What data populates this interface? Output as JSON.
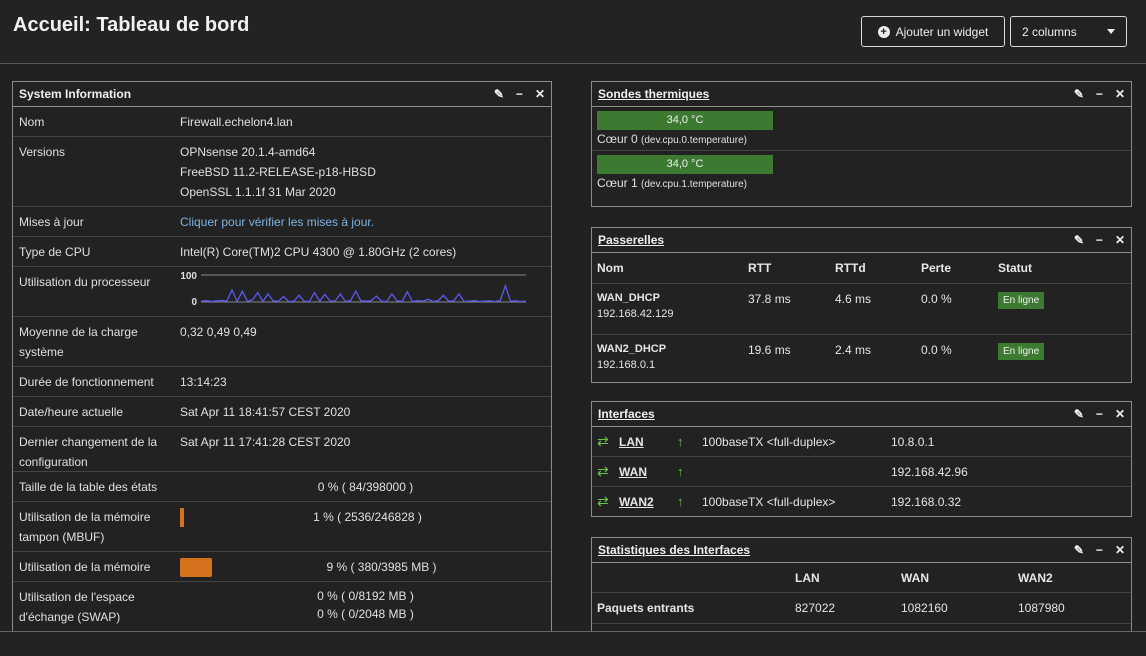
{
  "header": {
    "title": "Accueil: Tableau de bord",
    "add_widget": "Ajouter un widget",
    "columns": "2 columns"
  },
  "system": {
    "title": "System Information",
    "rows": {
      "name_label": "Nom",
      "name_value": "Firewall.echelon4.lan",
      "versions_label": "Versions",
      "versions_1": "OPNsense 20.1.4-amd64",
      "versions_2": "FreeBSD 11.2-RELEASE-p18-HBSD",
      "versions_3": "OpenSSL 1.1.1f 31 Mar 2020",
      "updates_label": "Mises à jour",
      "updates_value": "Cliquer pour vérifier les mises à jour.",
      "cpu_label": "Type de CPU",
      "cpu_value": "Intel(R) Core(TM)2 CPU 4300 @ 1.80GHz (2 cores)",
      "cpu_usage_label": "Utilisation du processeur",
      "cpu_max": "100",
      "cpu_min": "0",
      "load_label": "Moyenne de la charge système",
      "load_value": "0,32 0,49 0,49",
      "uptime_label": "Durée de fonctionnement",
      "uptime_value": "13:14:23",
      "date_label": "Date/heure actuelle",
      "date_value": "Sat Apr 11 18:41:57 CEST 2020",
      "config_label": "Dernier changement de la configuration",
      "config_value": "Sat Apr 11 17:41:28 CEST 2020",
      "states_label": "Taille de la table des états",
      "states_value": "0 % ( 84/398000 )",
      "mbuf_label": "Utilisation de la mémoire tampon (MBUF)",
      "mbuf_value": "1 % ( 2536/246828 )",
      "mbuf_fraction": 0.01,
      "mem_label": "Utilisation de la mémoire",
      "mem_value": "9 % ( 380/3985 MB )",
      "mem_fraction": 0.09,
      "swap_label": "Utilisation de l'espace d'échange (SWAP)",
      "swap_value_1": "0 % ( 0/8192 MB )",
      "swap_value_2": "0 % ( 0/2048 MB )"
    },
    "cpu_series": [
      3,
      5,
      2,
      4,
      6,
      3,
      45,
      2,
      40,
      3,
      8,
      35,
      2,
      30,
      4,
      3,
      20,
      2,
      3,
      25,
      3,
      2,
      35,
      3,
      28,
      4,
      3,
      30,
      2,
      5,
      40,
      4,
      3,
      5,
      22,
      3,
      2,
      30,
      4,
      3,
      38,
      2,
      5,
      3,
      10,
      2,
      5,
      25,
      3,
      4,
      30,
      2,
      3,
      5,
      2,
      3,
      4,
      2,
      5,
      60,
      3,
      4,
      2,
      3
    ]
  },
  "thermal": {
    "title": "Sondes thermiques",
    "sensors": [
      {
        "value": "34,0 °C",
        "name": "Cœur 0",
        "device": "(dev.cpu.0.temperature)"
      },
      {
        "value": "34,0 °C",
        "name": "Cœur 1",
        "device": "(dev.cpu.1.temperature)"
      }
    ]
  },
  "gateways": {
    "title": "Passerelles",
    "columns": [
      "Nom",
      "RTT",
      "RTTd",
      "Perte",
      "Statut"
    ],
    "rows": [
      {
        "name": "WAN_DHCP",
        "ip": "192.168.42.129",
        "rtt": "37.8 ms",
        "rttd": "4.6 ms",
        "loss": "0.0 %",
        "status": "En ligne"
      },
      {
        "name": "WAN2_DHCP",
        "ip": "192.168.0.1",
        "rtt": "19.6 ms",
        "rttd": "2.4 ms",
        "loss": "0.0 %",
        "status": "En ligne"
      }
    ]
  },
  "interfaces": {
    "title": "Interfaces",
    "rows": [
      {
        "name": "LAN",
        "media": "100baseTX <full-duplex>",
        "ip": "10.8.0.1"
      },
      {
        "name": "WAN",
        "media": "",
        "ip": "192.168.42.96"
      },
      {
        "name": "WAN2",
        "media": "100baseTX <full-duplex>",
        "ip": "192.168.0.32"
      }
    ]
  },
  "stats": {
    "title": "Statistiques des Interfaces",
    "columns": [
      "",
      "LAN",
      "WAN",
      "WAN2"
    ],
    "rows": [
      {
        "label": "Paquets entrants",
        "lan": "827022",
        "wan": "1082160",
        "wan2": "1087980"
      }
    ]
  }
}
